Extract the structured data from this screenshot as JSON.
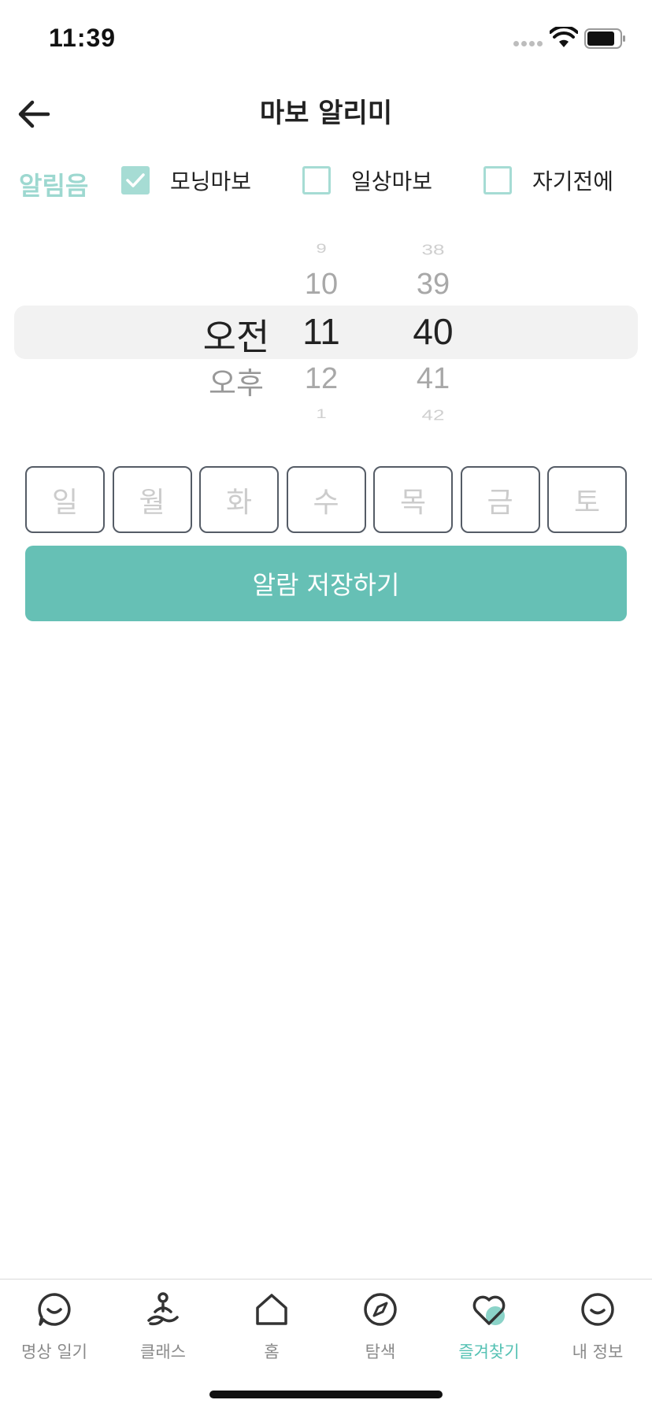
{
  "status_bar": {
    "time": "11:39"
  },
  "header": {
    "title": "마보 알리미"
  },
  "alarm_sound": {
    "label": "알림음",
    "options": [
      {
        "label": "모닝마보",
        "checked": true
      },
      {
        "label": "일상마보",
        "checked": false
      },
      {
        "label": "자기전에",
        "checked": false
      }
    ]
  },
  "picker": {
    "ampm": [
      "오전",
      "오후"
    ],
    "ampm_selected": "오전",
    "hours": [
      "9",
      "10",
      "11",
      "12",
      "1"
    ],
    "hour_selected": "11",
    "minutes": [
      "38",
      "39",
      "40",
      "41",
      "42"
    ],
    "minute_selected": "40"
  },
  "weekdays": [
    "일",
    "월",
    "화",
    "수",
    "목",
    "금",
    "토"
  ],
  "save_button": {
    "label": "알람 저장하기"
  },
  "tabs": [
    {
      "label": "명상 일기",
      "icon": "chat-smile-icon"
    },
    {
      "label": "클래스",
      "icon": "meditation-person-icon"
    },
    {
      "label": "홈",
      "icon": "home-icon"
    },
    {
      "label": "탐색",
      "icon": "compass-icon"
    },
    {
      "label": "즐겨찾기",
      "icon": "heart-icon",
      "active": true
    },
    {
      "label": "내 정보",
      "icon": "smile-face-icon"
    }
  ],
  "colors": {
    "accent": "#66c0b5",
    "accent_light": "#a6dcd4",
    "active_tab": "#56c2b4"
  }
}
